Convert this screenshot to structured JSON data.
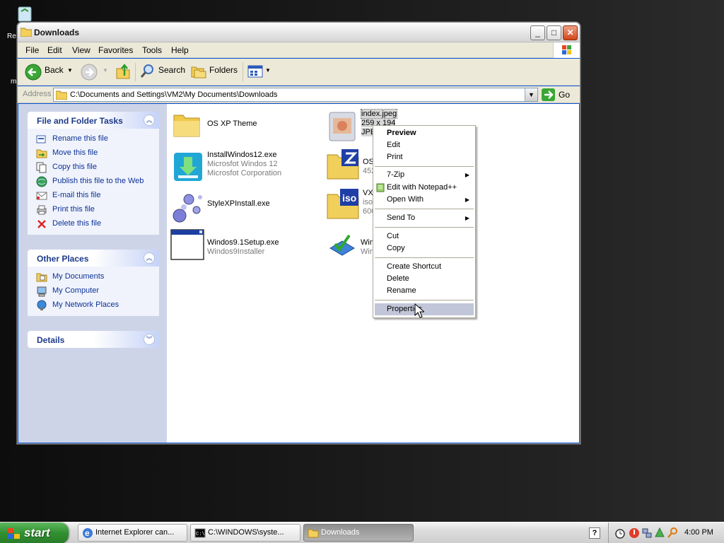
{
  "desktop": {
    "partial_label_1": "Re",
    "partial_label_2": "m"
  },
  "window": {
    "title": "Downloads",
    "min": "_",
    "max": "□",
    "close": "✕"
  },
  "menubar": {
    "items": [
      "File",
      "Edit",
      "View",
      "Favorites",
      "Tools",
      "Help"
    ]
  },
  "toolbar": {
    "back": "Back",
    "search": "Search",
    "folders": "Folders"
  },
  "address": {
    "label": "Address",
    "path": "C:\\Documents and Settings\\VM2\\My Documents\\Downloads",
    "go": "Go"
  },
  "taskpane": {
    "file_tasks": {
      "title": "File and Folder Tasks",
      "items": [
        "Rename this file",
        "Move this file",
        "Copy this file",
        "Publish this file to the Web",
        "E-mail this file",
        "Print this file",
        "Delete this file"
      ]
    },
    "other_places": {
      "title": "Other Places",
      "items": [
        "My Documents",
        "My Computer",
        "My Network Places"
      ]
    },
    "details": {
      "title": "Details"
    }
  },
  "files": [
    {
      "name": "OS XP Theme",
      "line2": "",
      "line3": "",
      "icon": "folder-icon"
    },
    {
      "name": "index.jpeg",
      "line2": "259 x 194",
      "line3": "JPE",
      "icon": "jpeg-icon"
    },
    {
      "name": "InstallWindos12.exe",
      "line2": "Microsfot Windos 12",
      "line3": "Microsfot Corporation",
      "icon": "installer-icon"
    },
    {
      "name": "OS",
      "line2": "452",
      "line3": "",
      "icon": "7zip-archive-icon"
    },
    {
      "name": "StyleXPInstall.exe",
      "line2": "",
      "line3": "",
      "icon": "stylexp-icon"
    },
    {
      "name": "VX2",
      "line2": "iso",
      "line3": "600",
      "icon": "iso-archive-icon"
    },
    {
      "name": "Windos9.1Setup.exe",
      "line2": "Windos9Installer",
      "line3": "",
      "icon": "setup-window-icon"
    },
    {
      "name": "Win",
      "line2": "Win",
      "line3": "",
      "icon": "update-icon"
    }
  ],
  "context_menu": {
    "preview": "Preview",
    "edit": "Edit",
    "print": "Print",
    "zip": "7-Zip",
    "notepad": "Edit with Notepad++",
    "open_with": "Open With",
    "send_to": "Send To",
    "cut": "Cut",
    "copy": "Copy",
    "create_shortcut": "Create Shortcut",
    "delete": "Delete",
    "rename": "Rename",
    "properties": "Properties"
  },
  "taskbar": {
    "start": "start",
    "buttons": [
      "Internet Explorer can...",
      "C:\\WINDOWS\\syste...",
      "Downloads"
    ],
    "clock": "4:00 PM"
  }
}
